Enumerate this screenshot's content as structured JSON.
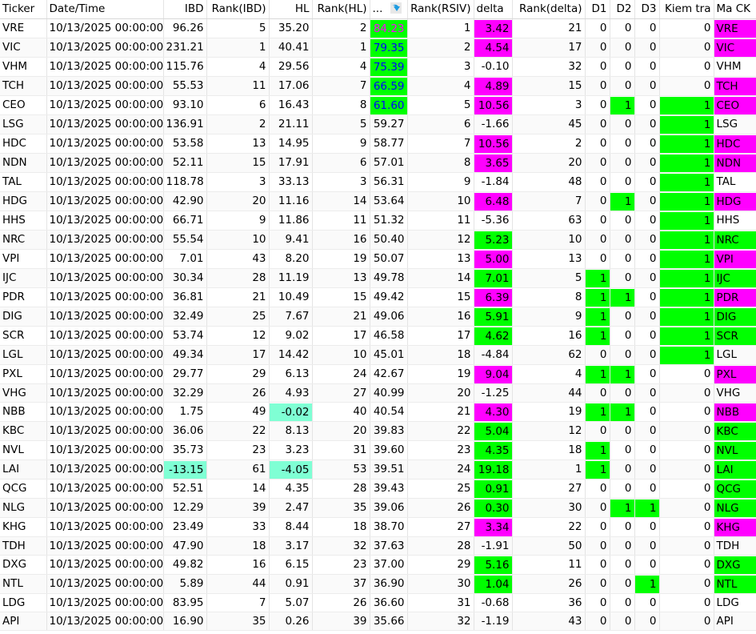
{
  "colors": {
    "m": "#ff00ff",
    "g": "#00ff00",
    "aq": "#7fffd4",
    "rsiv_bg": "#00ff00",
    "rsiv_first_text": "#ff00ff",
    "rsiv_text": "#0000ff"
  },
  "headers": [
    "Ticker",
    "Date/Time",
    "IBD",
    "Rank(IBD)",
    "HL",
    "Rank(HL)",
    "...",
    "Rank(RSIV)",
    "delta",
    "Rank(delta)",
    "D1",
    "D2",
    "D3",
    "Kiem tra",
    "Ma CK"
  ],
  "date": "10/13/2025 00:00:00",
  "rsiv_highlight_rows": 5,
  "rows": [
    [
      "VRE",
      "96.26",
      "5",
      "35.20",
      "2",
      "84.23",
      "1",
      "3.42",
      "m",
      "21",
      "0",
      "0",
      "0",
      "0",
      ""
    ],
    [
      "VIC",
      "231.21",
      "1",
      "40.41",
      "1",
      "79.35",
      "2",
      "4.54",
      "m",
      "17",
      "0",
      "0",
      "0",
      "0",
      ""
    ],
    [
      "VHM",
      "115.76",
      "4",
      "29.56",
      "4",
      "75.39",
      "3",
      "-0.10",
      "",
      "32",
      "0",
      "0",
      "0",
      "0",
      ""
    ],
    [
      "TCH",
      "55.53",
      "11",
      "17.06",
      "7",
      "66.59",
      "4",
      "4.89",
      "m",
      "15",
      "0",
      "0",
      "0",
      "0",
      ""
    ],
    [
      "CEO",
      "93.10",
      "6",
      "16.43",
      "8",
      "61.60",
      "5",
      "10.56",
      "m",
      "3",
      "0",
      "1",
      "0",
      "1",
      ""
    ],
    [
      "LSG",
      "136.91",
      "2",
      "21.11",
      "5",
      "59.27",
      "6",
      "-1.66",
      "",
      "45",
      "0",
      "0",
      "0",
      "1",
      ""
    ],
    [
      "HDC",
      "53.58",
      "13",
      "14.95",
      "9",
      "58.77",
      "7",
      "10.56",
      "m",
      "2",
      "0",
      "0",
      "0",
      "1",
      ""
    ],
    [
      "NDN",
      "52.11",
      "15",
      "17.91",
      "6",
      "57.01",
      "8",
      "3.65",
      "m",
      "20",
      "0",
      "0",
      "0",
      "1",
      ""
    ],
    [
      "TAL",
      "118.78",
      "3",
      "33.13",
      "3",
      "56.31",
      "9",
      "-1.84",
      "",
      "48",
      "0",
      "0",
      "0",
      "1",
      ""
    ],
    [
      "HDG",
      "42.90",
      "20",
      "11.16",
      "14",
      "53.64",
      "10",
      "6.48",
      "m",
      "7",
      "0",
      "1",
      "0",
      "1",
      ""
    ],
    [
      "HHS",
      "66.71",
      "9",
      "11.86",
      "11",
      "51.32",
      "11",
      "-5.36",
      "",
      "63",
      "0",
      "0",
      "0",
      "1",
      ""
    ],
    [
      "NRC",
      "55.54",
      "10",
      "9.41",
      "16",
      "50.40",
      "12",
      "5.23",
      "g",
      "10",
      "0",
      "0",
      "0",
      "1",
      ""
    ],
    [
      "VPI",
      "7.01",
      "43",
      "8.20",
      "19",
      "50.07",
      "13",
      "5.00",
      "m",
      "13",
      "0",
      "0",
      "0",
      "1",
      ""
    ],
    [
      "IJC",
      "30.34",
      "28",
      "11.19",
      "13",
      "49.78",
      "14",
      "7.01",
      "g",
      "5",
      "1",
      "0",
      "0",
      "1",
      ""
    ],
    [
      "PDR",
      "36.81",
      "21",
      "10.49",
      "15",
      "49.42",
      "15",
      "6.39",
      "m",
      "8",
      "1",
      "1",
      "0",
      "1",
      ""
    ],
    [
      "DIG",
      "32.49",
      "25",
      "7.67",
      "21",
      "49.06",
      "16",
      "5.91",
      "g",
      "9",
      "1",
      "0",
      "0",
      "1",
      ""
    ],
    [
      "SCR",
      "53.74",
      "12",
      "9.02",
      "17",
      "46.58",
      "17",
      "4.62",
      "g",
      "16",
      "1",
      "0",
      "0",
      "1",
      ""
    ],
    [
      "LGL",
      "49.34",
      "17",
      "14.42",
      "10",
      "45.01",
      "18",
      "-4.84",
      "",
      "62",
      "0",
      "0",
      "0",
      "1",
      ""
    ],
    [
      "PXL",
      "29.77",
      "29",
      "6.13",
      "24",
      "42.67",
      "19",
      "9.04",
      "m",
      "4",
      "1",
      "1",
      "0",
      "0",
      ""
    ],
    [
      "VHG",
      "32.29",
      "26",
      "4.93",
      "27",
      "40.99",
      "20",
      "-1.25",
      "",
      "44",
      "0",
      "0",
      "0",
      "0",
      ""
    ],
    [
      "NBB",
      "1.75",
      "49",
      "-0.02",
      "40",
      "40.54",
      "21",
      "4.30",
      "m",
      "19",
      "1",
      "1",
      "0",
      "0",
      "hl"
    ],
    [
      "KBC",
      "36.06",
      "22",
      "8.13",
      "20",
      "39.83",
      "22",
      "5.04",
      "g",
      "12",
      "0",
      "0",
      "0",
      "0",
      ""
    ],
    [
      "NVL",
      "35.73",
      "23",
      "3.23",
      "31",
      "39.60",
      "23",
      "4.35",
      "g",
      "18",
      "1",
      "0",
      "0",
      "0",
      ""
    ],
    [
      "LAI",
      "-13.15",
      "61",
      "-4.05",
      "53",
      "39.51",
      "24",
      "19.18",
      "g",
      "1",
      "1",
      "0",
      "0",
      "0",
      "ibd,hl"
    ],
    [
      "QCG",
      "52.51",
      "14",
      "4.35",
      "28",
      "39.43",
      "25",
      "0.91",
      "g",
      "27",
      "0",
      "0",
      "0",
      "0",
      ""
    ],
    [
      "NLG",
      "12.29",
      "39",
      "2.47",
      "35",
      "39.06",
      "26",
      "0.30",
      "g",
      "30",
      "0",
      "1",
      "1",
      "0",
      ""
    ],
    [
      "KHG",
      "23.49",
      "33",
      "8.44",
      "18",
      "38.70",
      "27",
      "3.34",
      "m",
      "22",
      "0",
      "0",
      "0",
      "0",
      ""
    ],
    [
      "TDH",
      "47.90",
      "18",
      "3.17",
      "32",
      "37.63",
      "28",
      "-1.91",
      "",
      "50",
      "0",
      "0",
      "0",
      "0",
      ""
    ],
    [
      "DXG",
      "49.82",
      "16",
      "6.15",
      "23",
      "37.00",
      "29",
      "5.16",
      "g",
      "11",
      "0",
      "0",
      "0",
      "0",
      ""
    ],
    [
      "NTL",
      "5.89",
      "44",
      "0.91",
      "37",
      "36.90",
      "30",
      "1.04",
      "g",
      "26",
      "0",
      "0",
      "1",
      "0",
      ""
    ],
    [
      "LDG",
      "83.95",
      "7",
      "5.07",
      "26",
      "36.60",
      "31",
      "-0.68",
      "",
      "36",
      "0",
      "0",
      "0",
      "0",
      ""
    ],
    [
      "API",
      "16.90",
      "35",
      "0.26",
      "39",
      "35.66",
      "32",
      "-1.19",
      "",
      "43",
      "0",
      "0",
      "0",
      "0",
      ""
    ]
  ]
}
